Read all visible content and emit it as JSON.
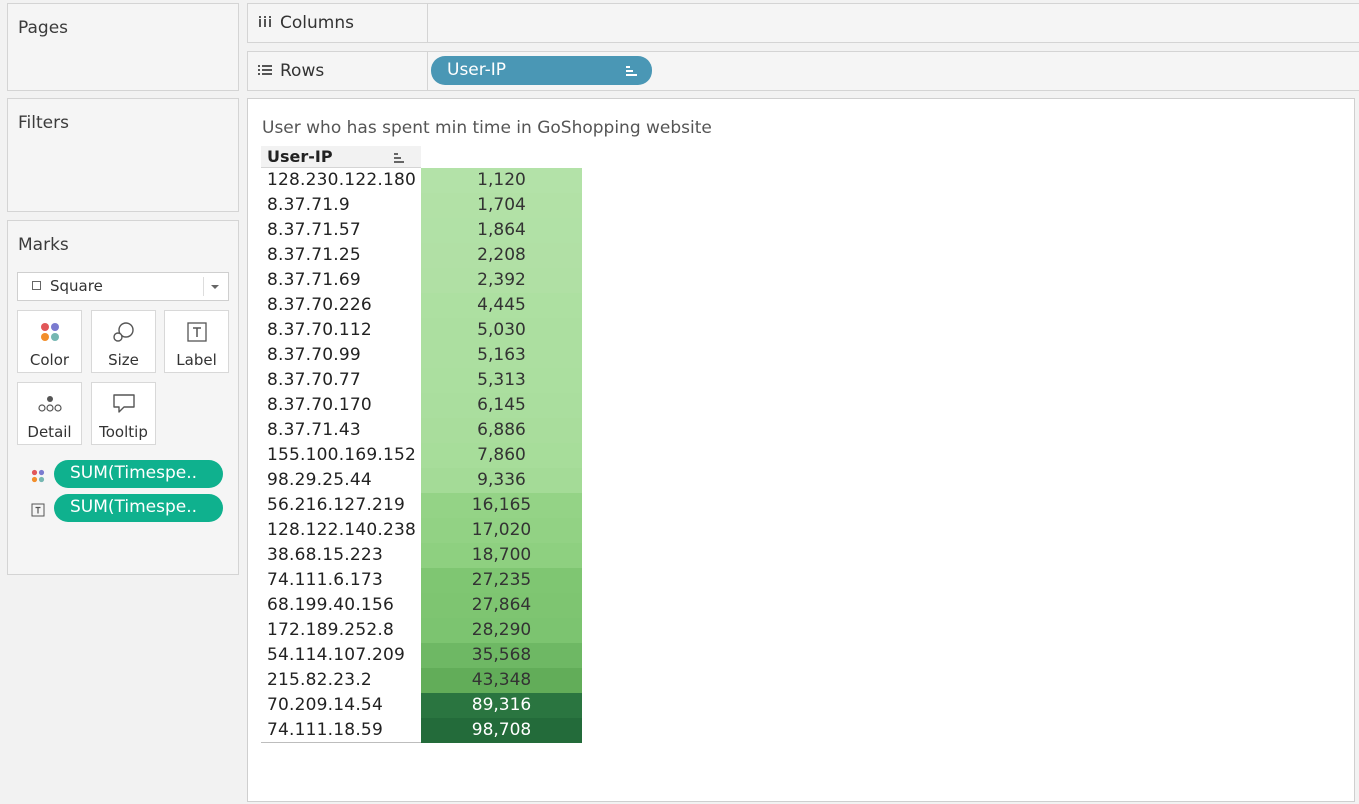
{
  "cards": {
    "pages_title": "Pages",
    "filters_title": "Filters",
    "marks_title": "Marks"
  },
  "marks": {
    "mark_type": "Square",
    "buttons": {
      "color": "Color",
      "size": "Size",
      "label": "Label",
      "detail": "Detail",
      "tooltip": "Tooltip"
    },
    "pills": [
      "SUM(Timespe..",
      "SUM(Timespe.."
    ]
  },
  "shelves": {
    "columns_label": "Columns",
    "rows_label": "Rows",
    "rows_pill": "User-IP"
  },
  "view": {
    "title": "User who has spent min time in GoShopping website",
    "header": "User-IP",
    "color_scale": {
      "low": "#b3e2a8",
      "high": "#236b3a"
    },
    "rows": [
      {
        "ip": "128.230.122.180",
        "value": "1,120",
        "color": "#b3e2a8",
        "dark": false
      },
      {
        "ip": "8.37.71.9",
        "value": "1,704",
        "color": "#b2e1a6",
        "dark": false
      },
      {
        "ip": "8.37.71.57",
        "value": "1,864",
        "color": "#b1e1a6",
        "dark": false
      },
      {
        "ip": "8.37.71.25",
        "value": "2,208",
        "color": "#b1e0a5",
        "dark": false
      },
      {
        "ip": "8.37.71.69",
        "value": "2,392",
        "color": "#b0e0a4",
        "dark": false
      },
      {
        "ip": "8.37.70.226",
        "value": "4,445",
        "color": "#ade0a1",
        "dark": false
      },
      {
        "ip": "8.37.70.112",
        "value": "5,030",
        "color": "#acdfa0",
        "dark": false
      },
      {
        "ip": "8.37.70.99",
        "value": "5,163",
        "color": "#acdfa0",
        "dark": false
      },
      {
        "ip": "8.37.70.77",
        "value": "5,313",
        "color": "#abdf9f",
        "dark": false
      },
      {
        "ip": "8.37.70.170",
        "value": "6,145",
        "color": "#aade9e",
        "dark": false
      },
      {
        "ip": "8.37.71.43",
        "value": "6,886",
        "color": "#a9dd9c",
        "dark": false
      },
      {
        "ip": "155.100.169.152",
        "value": "7,860",
        "color": "#a7dd9a",
        "dark": false
      },
      {
        "ip": "98.29.25.44",
        "value": "9,336",
        "color": "#a4db97",
        "dark": false
      },
      {
        "ip": "56.216.127.219",
        "value": "16,165",
        "color": "#94d386",
        "dark": false
      },
      {
        "ip": "128.122.140.238",
        "value": "17,020",
        "color": "#92d284",
        "dark": false
      },
      {
        "ip": "38.68.15.223",
        "value": "18,700",
        "color": "#8ed080",
        "dark": false
      },
      {
        "ip": "74.111.6.173",
        "value": "27,235",
        "color": "#7fc672",
        "dark": false
      },
      {
        "ip": "68.199.40.156",
        "value": "27,864",
        "color": "#7ec571",
        "dark": false
      },
      {
        "ip": "172.189.252.8",
        "value": "28,290",
        "color": "#7cc470",
        "dark": false
      },
      {
        "ip": "54.114.107.209",
        "value": "35,568",
        "color": "#6eb864",
        "dark": false
      },
      {
        "ip": "215.82.23.2",
        "value": "43,348",
        "color": "#62ad59",
        "dark": false
      },
      {
        "ip": "70.209.14.54",
        "value": "89,316",
        "color": "#2a7540",
        "dark": true
      },
      {
        "ip": "74.111.18.59",
        "value": "98,708",
        "color": "#236b3a",
        "dark": true
      }
    ]
  }
}
